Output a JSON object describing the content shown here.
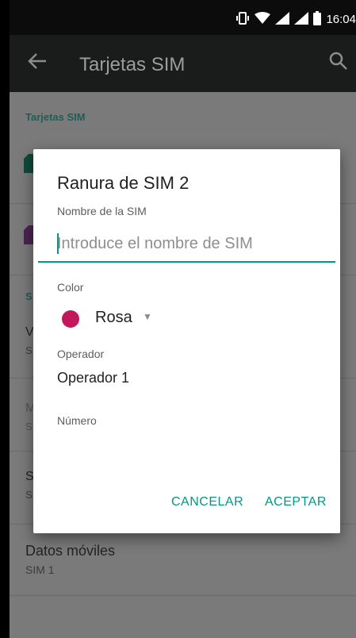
{
  "status_bar": {
    "time": "16:04"
  },
  "app_bar": {
    "title": "Tarjetas SIM"
  },
  "background": {
    "section_header": "Tarjetas SIM",
    "items": [
      {
        "primary": "Datos móviles",
        "secondary": "SIM 1"
      }
    ],
    "partial_letters": [
      "S",
      "V",
      "S",
      "M",
      "S",
      "S",
      "S"
    ]
  },
  "dialog": {
    "title": "Ranura de SIM 2",
    "sim_name_label": "Nombre de la SIM",
    "sim_name_placeholder": "Introduce el nombre de SIM",
    "sim_name_value": "",
    "color_label": "Color",
    "color_value": "Rosa",
    "color_hex": "#c2185b",
    "operator_label": "Operador",
    "operator_value": "Operador 1",
    "number_label": "Número",
    "cancel": "CANCELAR",
    "accept": "ACEPTAR"
  },
  "colors": {
    "accent": "#009688",
    "appbar": "#1a1c1c"
  }
}
